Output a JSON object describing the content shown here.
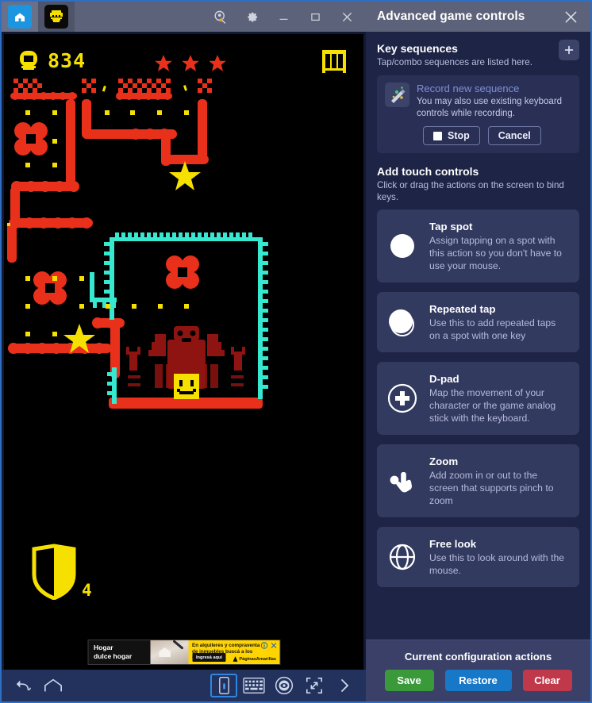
{
  "window": {
    "tabs": [
      {
        "name": "home-tab",
        "icon": "home-icon",
        "label": "Home"
      },
      {
        "name": "game-tab",
        "icon": "game-app-icon",
        "label": "Game"
      }
    ],
    "controls": [
      {
        "name": "search-star-button",
        "icon": "search-star-icon",
        "label": "Search"
      },
      {
        "name": "settings-button",
        "icon": "gear-icon",
        "label": "Settings"
      },
      {
        "name": "minimize-button",
        "icon": "minimize-icon",
        "label": "Minimize"
      },
      {
        "name": "maximize-button",
        "icon": "maximize-icon",
        "label": "Maximize"
      },
      {
        "name": "close-button",
        "icon": "close-icon",
        "label": "Close"
      }
    ]
  },
  "game": {
    "score": "834",
    "stars_collected": 3,
    "shield_count": "4",
    "hud_gate_icon": "gate-icon",
    "coin_icon": "coin-icon",
    "ad": {
      "headline_line1": "Hogar",
      "headline_line2": "dulce hogar",
      "body": "En alquileres y compraventa de inmuebles buscá a los que saben",
      "cta": "Ingresá aquí",
      "brand": "PáginasAmarillas",
      "info_icon": "ad-info-icon",
      "close_icon": "ad-close-icon"
    }
  },
  "navbar": {
    "items": [
      {
        "name": "back-button",
        "icon": "back-arrow-icon",
        "label": "Back",
        "selected": false
      },
      {
        "name": "home-button",
        "icon": "home-pentagon-icon",
        "label": "Home",
        "selected": false
      },
      {
        "name": "shake-button",
        "icon": "shake-phone-icon",
        "label": "Shake",
        "selected": true
      },
      {
        "name": "keyboard-button",
        "icon": "keyboard-icon",
        "label": "Keyboard",
        "selected": false
      },
      {
        "name": "eye-button",
        "icon": "eye-target-icon",
        "label": "Eye",
        "selected": false
      },
      {
        "name": "fullscreen-button",
        "icon": "fullscreen-icon",
        "label": "Fullscreen",
        "selected": false
      },
      {
        "name": "expand-more-button",
        "icon": "chevron-right-icon",
        "label": "More",
        "selected": false
      }
    ]
  },
  "panel": {
    "title": "Advanced game controls",
    "close_label": "Close",
    "key_sequences": {
      "title": "Key sequences",
      "subtitle": "Tap/combo sequences are listed here.",
      "add_label": "+",
      "record": {
        "icon": "magic-wand-icon",
        "title": "Record new sequence",
        "subtitle": "You may also use existing keyboard controls while recording.",
        "stop_label": "Stop",
        "cancel_label": "Cancel"
      }
    },
    "touch_controls": {
      "title": "Add touch controls",
      "subtitle": "Click or drag the actions on the screen to bind keys.",
      "items": [
        {
          "icon": "tap-spot-icon",
          "name": "Tap spot",
          "desc": "Assign tapping on a spot with this action so you don't have to use your mouse."
        },
        {
          "icon": "repeated-tap-icon",
          "name": "Repeated tap",
          "desc": "Use this to add repeated taps on a spot with one key"
        },
        {
          "icon": "dpad-icon",
          "name": "D-pad",
          "desc": "Map the movement of your character or the game analog stick with the keyboard."
        },
        {
          "icon": "pinch-zoom-icon",
          "name": "Zoom",
          "desc": "Add zoom in or out to the screen that supports pinch to zoom"
        },
        {
          "icon": "free-look-icon",
          "name": "Free look",
          "desc": "Use this to look around with the mouse."
        }
      ]
    },
    "footer": {
      "title": "Current configuration actions",
      "save_label": "Save",
      "restore_label": "Restore",
      "clear_label": "Clear"
    }
  },
  "colors": {
    "panel_bg": "#1e2445",
    "card_bg": "#333a60",
    "header_bg": "#5c6279",
    "accent_blue": "#2e6fc4",
    "save_green": "#3a9a3a",
    "restore_blue": "#1878c8",
    "clear_red": "#c0394b",
    "game_red": "#e8301a",
    "game_yellow": "#f5e000",
    "game_cyan": "#36e8d0"
  }
}
